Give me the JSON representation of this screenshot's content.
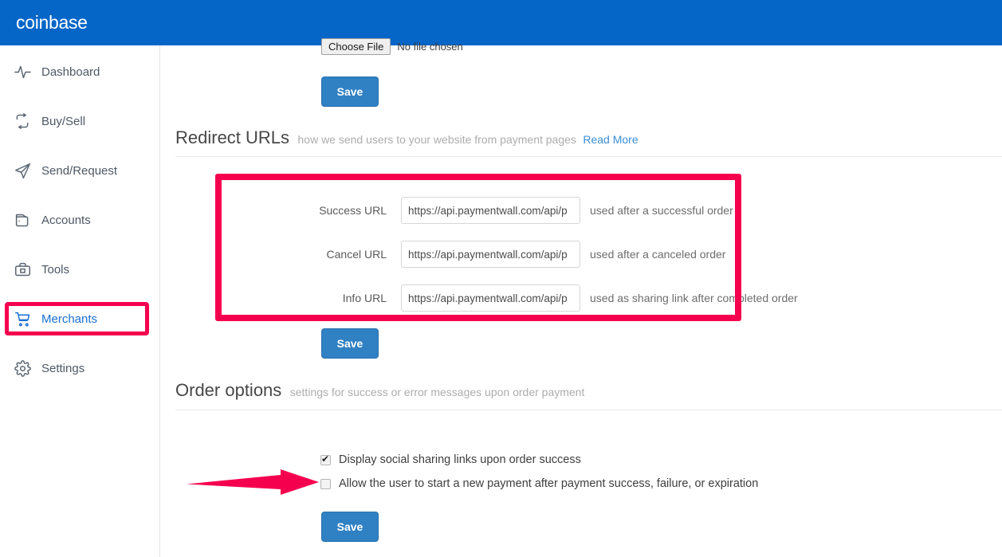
{
  "brand": {
    "name": "coinbase",
    "header_color": "#0566c8"
  },
  "sidebar": {
    "items": [
      {
        "label": "Dashboard",
        "icon": "activity-pulse-icon",
        "active": false
      },
      {
        "label": "Buy/Sell",
        "icon": "swap-arrows-icon",
        "active": false
      },
      {
        "label": "Send/Request",
        "icon": "paper-plane-icon",
        "active": false
      },
      {
        "label": "Accounts",
        "icon": "wallet-icon",
        "active": false
      },
      {
        "label": "Tools",
        "icon": "briefcase-icon",
        "active": false
      },
      {
        "label": "Merchants",
        "icon": "shopping-cart-icon",
        "active": true
      },
      {
        "label": "Settings",
        "icon": "gear-icon",
        "active": false
      }
    ]
  },
  "upload": {
    "choose_file_label": "Choose File",
    "no_file_text": "No file chosen",
    "save_label": "Save"
  },
  "redirect_urls": {
    "title": "Redirect URLs",
    "subtitle": "how we send users to your website from payment pages",
    "read_more": "Read More",
    "fields": [
      {
        "label": "Success URL",
        "value": "https://api.paymentwall.com/api/p",
        "hint": "used after a successful order"
      },
      {
        "label": "Cancel URL",
        "value": "https://api.paymentwall.com/api/p",
        "hint": "used after a canceled order"
      },
      {
        "label": "Info URL",
        "value": "https://api.paymentwall.com/api/p",
        "hint": "used as sharing link after completed order"
      }
    ],
    "save_label": "Save"
  },
  "order_options": {
    "title": "Order options",
    "subtitle": "settings for success or error messages upon order payment",
    "checkboxes": [
      {
        "label": "Display social sharing links upon order success",
        "checked": true
      },
      {
        "label": "Allow the user to start a new payment after payment success, failure, or expiration",
        "checked": false
      }
    ],
    "save_label": "Save"
  },
  "annotations": {
    "box_color": "#f5004f",
    "arrow_color": "#f5004f"
  }
}
